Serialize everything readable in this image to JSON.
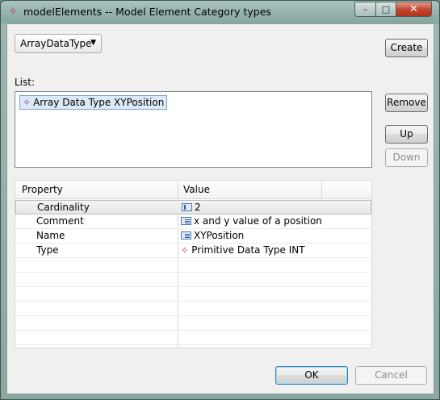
{
  "window": {
    "title": "modelElements -- Model Element Category types",
    "title_icon": "model-element-icon",
    "controls": {
      "minimize": "–",
      "maximize": "□",
      "close": "✕"
    }
  },
  "category_select": {
    "value": "ArrayDataType",
    "arrow": "▼"
  },
  "buttons": {
    "create": "Create",
    "remove": "Remove",
    "up": "Up",
    "down": "Down",
    "ok": "OK",
    "cancel": "Cancel"
  },
  "list": {
    "label": "List:",
    "items": [
      {
        "label": "Array Data Type XYPosition",
        "icon": "array-data-type-icon"
      }
    ]
  },
  "properties": {
    "columns": [
      "Property",
      "Value"
    ],
    "rows": [
      {
        "property": "Cardinality",
        "value": "2",
        "icon": "cardinality-icon"
      },
      {
        "property": "Comment",
        "value": "x and y value of a position",
        "icon": "text-field-icon"
      },
      {
        "property": "Name",
        "value": "XYPosition",
        "icon": "text-field-icon"
      },
      {
        "property": "Type",
        "value": "Primitive Data Type INT",
        "icon": "primitive-type-icon"
      }
    ]
  },
  "colors": {
    "selection_bg": "#dceaf7",
    "selection_border": "#7da2ce",
    "model_icon": "#b0306a",
    "default_button_border": "#3c7fb1"
  }
}
